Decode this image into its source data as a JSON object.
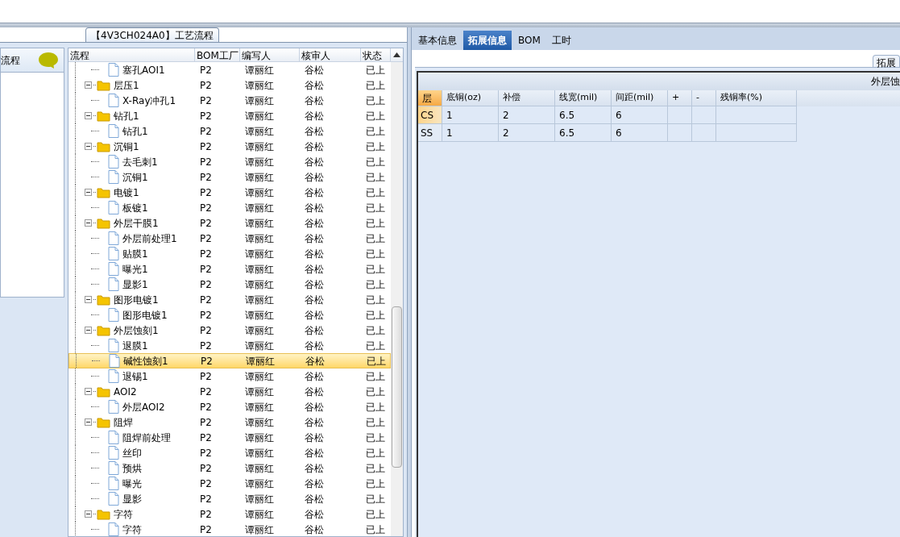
{
  "sidebar": {
    "label": "流程"
  },
  "panel_title": "【4V3CH024A0】工艺流程",
  "grid": {
    "columns": [
      "流程",
      "BOM工厂",
      "编写人",
      "核审人",
      "状态"
    ],
    "rows": [
      {
        "kind": "file",
        "label": "塞孔AOI1",
        "bom": "P2",
        "writer": "谭丽红",
        "reviewer": "谷松",
        "status": "已上",
        "selected": false
      },
      {
        "kind": "folder",
        "label": "层压1",
        "bom": "P2",
        "writer": "谭丽红",
        "reviewer": "谷松",
        "status": "已上",
        "selected": false,
        "expanded": true,
        "children": [
          {
            "kind": "file",
            "label": "X-Ray冲孔1",
            "bom": "P2",
            "writer": "谭丽红",
            "reviewer": "谷松",
            "status": "已上",
            "selected": false
          }
        ]
      },
      {
        "kind": "folder",
        "label": "钻孔1",
        "bom": "P2",
        "writer": "谭丽红",
        "reviewer": "谷松",
        "status": "已上",
        "selected": false,
        "expanded": true,
        "children": [
          {
            "kind": "file",
            "label": "钻孔1",
            "bom": "P2",
            "writer": "谭丽红",
            "reviewer": "谷松",
            "status": "已上",
            "selected": false
          }
        ]
      },
      {
        "kind": "folder",
        "label": "沉铜1",
        "bom": "P2",
        "writer": "谭丽红",
        "reviewer": "谷松",
        "status": "已上",
        "selected": false,
        "expanded": true,
        "children": [
          {
            "kind": "file",
            "label": "去毛刺1",
            "bom": "P2",
            "writer": "谭丽红",
            "reviewer": "谷松",
            "status": "已上",
            "selected": false
          },
          {
            "kind": "file",
            "label": "沉铜1",
            "bom": "P2",
            "writer": "谭丽红",
            "reviewer": "谷松",
            "status": "已上",
            "selected": false
          }
        ]
      },
      {
        "kind": "folder",
        "label": "电镀1",
        "bom": "P2",
        "writer": "谭丽红",
        "reviewer": "谷松",
        "status": "已上",
        "selected": false,
        "expanded": true,
        "children": [
          {
            "kind": "file",
            "label": "板镀1",
            "bom": "P2",
            "writer": "谭丽红",
            "reviewer": "谷松",
            "status": "已上",
            "selected": false
          }
        ]
      },
      {
        "kind": "folder",
        "label": "外层干膜1",
        "bom": "P2",
        "writer": "谭丽红",
        "reviewer": "谷松",
        "status": "已上",
        "selected": false,
        "expanded": true,
        "children": [
          {
            "kind": "file",
            "label": "外层前处理1",
            "bom": "P2",
            "writer": "谭丽红",
            "reviewer": "谷松",
            "status": "已上",
            "selected": false
          },
          {
            "kind": "file",
            "label": "贴膜1",
            "bom": "P2",
            "writer": "谭丽红",
            "reviewer": "谷松",
            "status": "已上",
            "selected": false
          },
          {
            "kind": "file",
            "label": "曝光1",
            "bom": "P2",
            "writer": "谭丽红",
            "reviewer": "谷松",
            "status": "已上",
            "selected": false
          },
          {
            "kind": "file",
            "label": "显影1",
            "bom": "P2",
            "writer": "谭丽红",
            "reviewer": "谷松",
            "status": "已上",
            "selected": false
          }
        ]
      },
      {
        "kind": "folder",
        "label": "图形电镀1",
        "bom": "P2",
        "writer": "谭丽红",
        "reviewer": "谷松",
        "status": "已上",
        "selected": false,
        "expanded": true,
        "children": [
          {
            "kind": "file",
            "label": "图形电镀1",
            "bom": "P2",
            "writer": "谭丽红",
            "reviewer": "谷松",
            "status": "已上",
            "selected": false
          }
        ]
      },
      {
        "kind": "folder",
        "label": "外层蚀刻1",
        "bom": "P2",
        "writer": "谭丽红",
        "reviewer": "谷松",
        "status": "已上",
        "selected": false,
        "expanded": true,
        "children": [
          {
            "kind": "file",
            "label": "退膜1",
            "bom": "P2",
            "writer": "谭丽红",
            "reviewer": "谷松",
            "status": "已上",
            "selected": false
          },
          {
            "kind": "file",
            "label": "碱性蚀刻1",
            "bom": "P2",
            "writer": "谭丽红",
            "reviewer": "谷松",
            "status": "已上",
            "selected": true
          },
          {
            "kind": "file",
            "label": "退锡1",
            "bom": "P2",
            "writer": "谭丽红",
            "reviewer": "谷松",
            "status": "已上",
            "selected": false
          }
        ]
      },
      {
        "kind": "folder",
        "label": "AOI2",
        "bom": "P2",
        "writer": "谭丽红",
        "reviewer": "谷松",
        "status": "已上",
        "selected": false,
        "expanded": true,
        "children": [
          {
            "kind": "file",
            "label": "外层AOI2",
            "bom": "P2",
            "writer": "谭丽红",
            "reviewer": "谷松",
            "status": "已上",
            "selected": false
          }
        ]
      },
      {
        "kind": "folder",
        "label": "阻焊",
        "bom": "P2",
        "writer": "谭丽红",
        "reviewer": "谷松",
        "status": "已上",
        "selected": false,
        "expanded": true,
        "children": [
          {
            "kind": "file",
            "label": "阻焊前处理",
            "bom": "P2",
            "writer": "谭丽红",
            "reviewer": "谷松",
            "status": "已上",
            "selected": false
          },
          {
            "kind": "file",
            "label": "丝印",
            "bom": "P2",
            "writer": "谭丽红",
            "reviewer": "谷松",
            "status": "已上",
            "selected": false
          },
          {
            "kind": "file",
            "label": "预烘",
            "bom": "P2",
            "writer": "谭丽红",
            "reviewer": "谷松",
            "status": "已上",
            "selected": false
          },
          {
            "kind": "file",
            "label": "曝光",
            "bom": "P2",
            "writer": "谭丽红",
            "reviewer": "谷松",
            "status": "已上",
            "selected": false
          },
          {
            "kind": "file",
            "label": "显影",
            "bom": "P2",
            "writer": "谭丽红",
            "reviewer": "谷松",
            "status": "已上",
            "selected": false
          }
        ]
      },
      {
        "kind": "folder",
        "label": "字符",
        "bom": "P2",
        "writer": "谭丽红",
        "reviewer": "谷松",
        "status": "已上",
        "selected": false,
        "expanded": true,
        "children": [
          {
            "kind": "file",
            "label": "字符",
            "bom": "P2",
            "writer": "谭丽红",
            "reviewer": "谷松",
            "status": "已上",
            "selected": false
          }
        ]
      }
    ]
  },
  "tabs": [
    {
      "label": "基本信息",
      "selected": false
    },
    {
      "label": "拓展信息",
      "selected": true
    },
    {
      "label": "BOM",
      "selected": false
    },
    {
      "label": "工时",
      "selected": false
    }
  ],
  "sub_tab": "拓展",
  "section_title": "外层蚀",
  "layer_table": {
    "columns": [
      "层",
      "底铜(oz)",
      "补偿",
      "线宽(mil)",
      "间距(mil)",
      "+",
      "-",
      "残铜率(%)"
    ],
    "rows": [
      {
        "cells": [
          "CS",
          "1",
          "2",
          "6.5",
          "6",
          "",
          "",
          ""
        ],
        "selected": true
      },
      {
        "cells": [
          "SS",
          "1",
          "2",
          "6.5",
          "6",
          "",
          "",
          ""
        ],
        "selected": false
      }
    ]
  }
}
